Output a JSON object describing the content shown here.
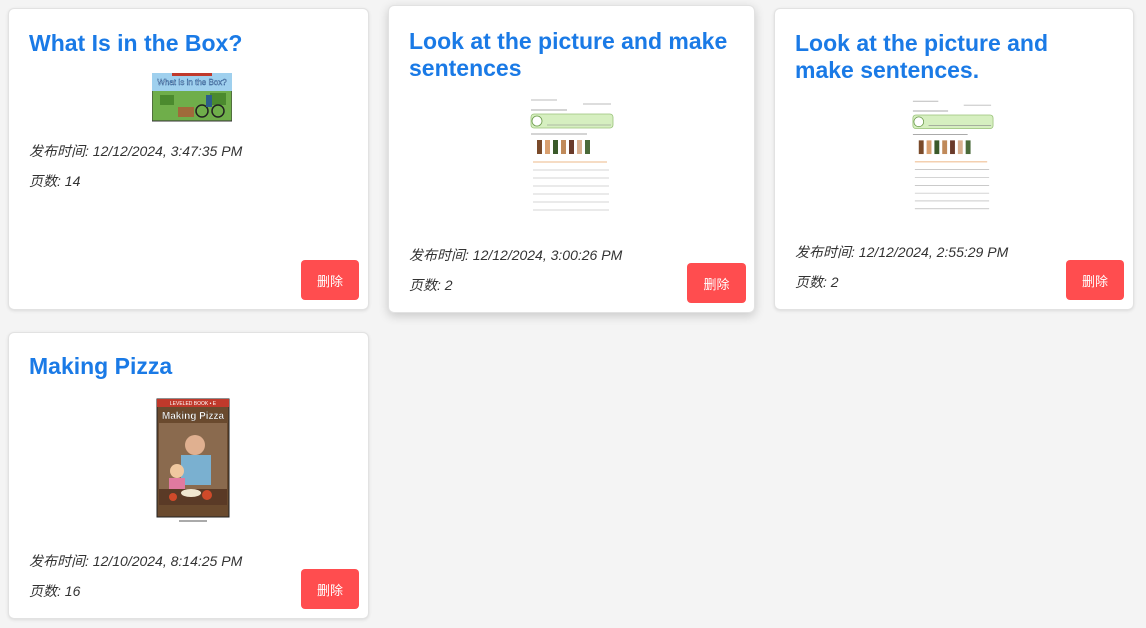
{
  "colors": {
    "title": "#1a7ae6",
    "delete_bg": "#ff4d4f",
    "background": "#f4f4f4"
  },
  "cards": [
    {
      "title": "What Is in the Box?",
      "thumb_cover_text": "What Is in the Box?",
      "published": "发布时间: 12/12/2024, 3:47:35 PM",
      "pages": "页数: 14",
      "delete_label": "删除"
    },
    {
      "title": "Look at the picture and make sentences",
      "published": "发布时间: 12/12/2024, 3:00:26 PM",
      "pages": "页数: 2",
      "delete_label": "删除"
    },
    {
      "title": "Look at the picture and make sentences.",
      "published": "发布时间: 12/12/2024, 2:55:29 PM",
      "pages": "页数: 2",
      "delete_label": "删除"
    },
    {
      "title": "Making Pizza",
      "thumb_cover_text": "Making Pizza",
      "thumb_banner_text": "LEVELED BOOK • E",
      "published": "发布时间: 12/10/2024, 8:14:25 PM",
      "pages": "页数: 16",
      "delete_label": "删除"
    }
  ]
}
